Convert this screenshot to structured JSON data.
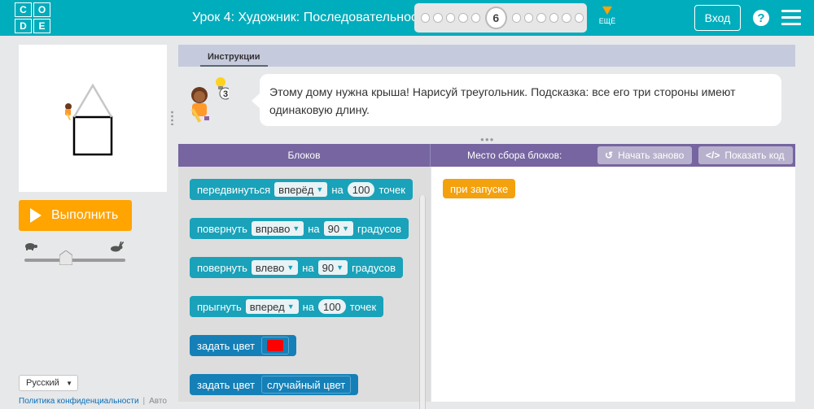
{
  "header": {
    "logo_letters": [
      "C",
      "O",
      "D",
      "E"
    ],
    "lesson_title": "Урок 4: Художник: Последовательность",
    "current_level": "6",
    "more_label": "ЕЩЁ",
    "login_label": "Вход",
    "help_label": "?"
  },
  "left": {
    "run_label": "Выполнить",
    "speed_slow_icon": "turtle-icon",
    "speed_fast_icon": "rabbit-icon",
    "speed_level": 0.4,
    "language": "Русский",
    "privacy_link": "Политика конфиденциальности",
    "footer_more": "Авторские"
  },
  "instructions": {
    "tab_label": "Инструкции",
    "hint_count": "3",
    "text": "Этому дому нужна крыша! Нарисуй треугольник. Подсказка: все его три стороны имеют одинаковую длину."
  },
  "workspace": {
    "toolbox_title": "Блоков",
    "area_title": "Место сбора блоков:",
    "reset_label": "Начать заново",
    "show_code_label": "Показать код"
  },
  "blocks": {
    "move": {
      "label": "передвинуться",
      "direction": "вперёд",
      "on": "на",
      "value": "100",
      "unit": "точек"
    },
    "turn_right": {
      "label": "повернуть",
      "direction": "вправо",
      "on": "на",
      "value": "90",
      "unit": "градусов"
    },
    "turn_left": {
      "label": "повернуть",
      "direction": "влево",
      "on": "на",
      "value": "90",
      "unit": "градусов"
    },
    "jump": {
      "label": "прыгнуть",
      "direction": "вперед",
      "on": "на",
      "value": "100",
      "unit": "точек"
    },
    "set_color": {
      "label": "задать цвет",
      "color": "#ff0000"
    },
    "set_random_color": {
      "label": "задать цвет",
      "value": "случайный цвет"
    },
    "when_run": {
      "label": "при запуске"
    }
  },
  "colors": {
    "header_bg": "#00adbc",
    "run_button": "#ffa400",
    "workspace_header": "#7665a0",
    "block_teal": "#19a2b9",
    "block_blue": "#1580b7",
    "event_orange": "#f4a10e"
  }
}
